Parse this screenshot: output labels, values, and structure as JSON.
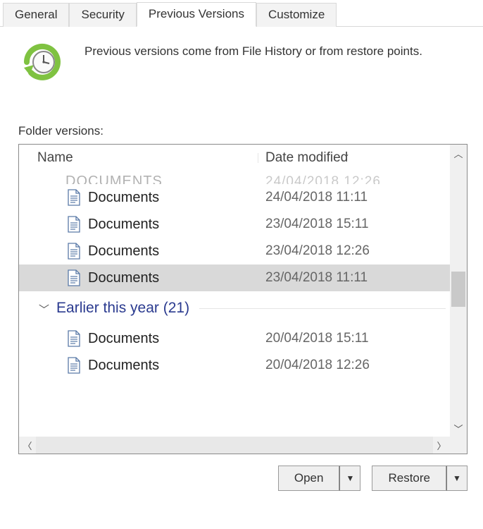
{
  "tabs": {
    "general": "General",
    "security": "Security",
    "previous_versions": "Previous Versions",
    "customize": "Customize"
  },
  "info_text": "Previous versions come from File History or from restore points.",
  "folder_versions_label": "Folder versions:",
  "columns": {
    "name": "Name",
    "date": "Date modified"
  },
  "cut_row": {
    "name": "Documents",
    "date": "24/04/2018 12:26"
  },
  "rows": [
    {
      "name": "Documents",
      "date": "24/04/2018 11:11",
      "selected": false
    },
    {
      "name": "Documents",
      "date": "23/04/2018 15:11",
      "selected": false
    },
    {
      "name": "Documents",
      "date": "23/04/2018 12:26",
      "selected": false
    },
    {
      "name": "Documents",
      "date": "23/04/2018 11:11",
      "selected": true
    }
  ],
  "group": {
    "label": "Earlier this year (21)"
  },
  "rows2": [
    {
      "name": "Documents",
      "date": "20/04/2018 15:11"
    },
    {
      "name": "Documents",
      "date": "20/04/2018 12:26"
    }
  ],
  "buttons": {
    "open": "Open",
    "restore": "Restore"
  }
}
